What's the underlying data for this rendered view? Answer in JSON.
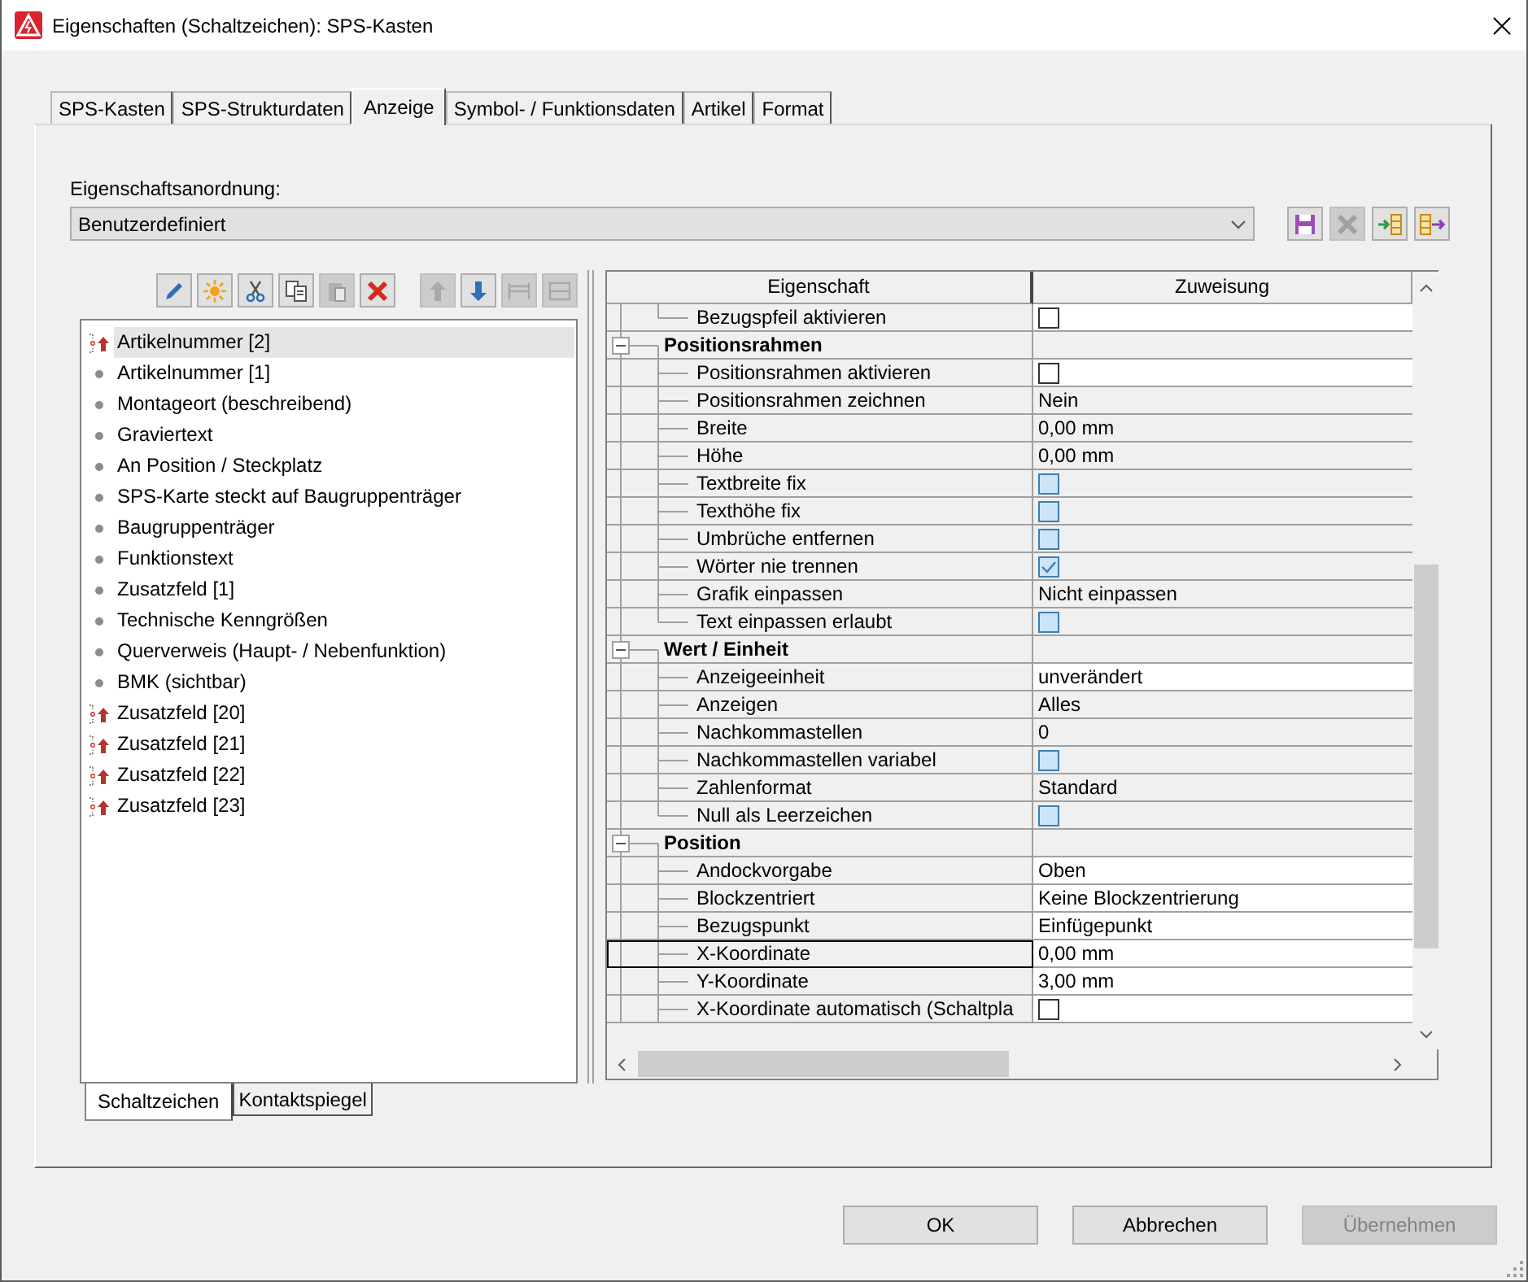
{
  "window": {
    "title": "Eigenschaften (Schaltzeichen): SPS-Kasten"
  },
  "tabs": [
    {
      "label": "SPS-Kasten",
      "selected": false
    },
    {
      "label": "SPS-Strukturdaten",
      "selected": false
    },
    {
      "label": "Anzeige",
      "selected": true
    },
    {
      "label": "Symbol- / Funktionsdaten",
      "selected": false
    },
    {
      "label": "Artikel",
      "selected": false
    },
    {
      "label": "Format",
      "selected": false
    }
  ],
  "arrangement": {
    "label": "Eigenschaftsanordnung:",
    "value": "Benutzerdefiniert",
    "buttons": [
      {
        "kind": "save",
        "disabled": false
      },
      {
        "kind": "delete",
        "disabled": true
      },
      {
        "kind": "import",
        "disabled": false
      },
      {
        "kind": "export",
        "disabled": false
      }
    ]
  },
  "toolbar": [
    {
      "kind": "edit",
      "disabled": false
    },
    {
      "kind": "new",
      "disabled": false
    },
    {
      "kind": "cut",
      "disabled": false
    },
    {
      "kind": "copy",
      "disabled": false
    },
    {
      "kind": "paste",
      "disabled": true
    },
    {
      "kind": "delete",
      "disabled": false
    },
    {
      "kind": "up",
      "disabled": true
    },
    {
      "kind": "down",
      "disabled": false
    },
    {
      "kind": "spacing",
      "disabled": true
    },
    {
      "kind": "frame",
      "disabled": true
    }
  ],
  "list": [
    {
      "label": "Artikelnummer [2]",
      "kind": "linked",
      "selected": true
    },
    {
      "label": "Artikelnummer [1]",
      "kind": "plain",
      "selected": false
    },
    {
      "label": "Montageort (beschreibend)",
      "kind": "plain",
      "selected": false
    },
    {
      "label": "Graviertext",
      "kind": "plain",
      "selected": false
    },
    {
      "label": "An Position / Steckplatz",
      "kind": "plain",
      "selected": false
    },
    {
      "label": "SPS-Karte steckt auf Baugruppenträger",
      "kind": "plain",
      "selected": false
    },
    {
      "label": "Baugruppenträger",
      "kind": "plain",
      "selected": false
    },
    {
      "label": "Funktionstext",
      "kind": "plain",
      "selected": false
    },
    {
      "label": "Zusatzfeld [1]",
      "kind": "plain",
      "selected": false
    },
    {
      "label": "Technische Kenngrößen",
      "kind": "plain",
      "selected": false
    },
    {
      "label": "Querverweis (Haupt- / Nebenfunktion)",
      "kind": "plain",
      "selected": false
    },
    {
      "label": "BMK (sichtbar)",
      "kind": "plain",
      "selected": false
    },
    {
      "label": "Zusatzfeld [20]",
      "kind": "linked",
      "selected": false
    },
    {
      "label": "Zusatzfeld [21]",
      "kind": "linked",
      "selected": false
    },
    {
      "label": "Zusatzfeld [22]",
      "kind": "linked",
      "selected": false
    },
    {
      "label": "Zusatzfeld [23]",
      "kind": "linked",
      "selected": false
    }
  ],
  "bottom_tabs": [
    {
      "label": "Schaltzeichen",
      "selected": true
    },
    {
      "label": "Kontaktspiegel",
      "selected": false
    }
  ],
  "grid": {
    "columns": [
      "Eigenschaft",
      "Zuweisung"
    ],
    "rows": [
      {
        "kind": "checkbox",
        "label": "Bezugspfeil aktivieren",
        "checked": false,
        "editable": true,
        "selected": false
      },
      {
        "kind": "group",
        "label": "Positionsrahmen",
        "expanded": true,
        "children": [
          {
            "kind": "checkbox",
            "label": "Positionsrahmen aktivieren",
            "checked": false,
            "editable": true,
            "selected": false
          },
          {
            "kind": "text",
            "label": "Positionsrahmen zeichnen",
            "value": "Nein",
            "editable": false,
            "selected": false
          },
          {
            "kind": "text",
            "label": "Breite",
            "value": "0,00 mm",
            "editable": false,
            "selected": false
          },
          {
            "kind": "text",
            "label": "Höhe",
            "value": "0,00 mm",
            "editable": false,
            "selected": false
          },
          {
            "kind": "checkbox",
            "label": "Textbreite fix",
            "checked": false,
            "editable": false,
            "selected": false
          },
          {
            "kind": "checkbox",
            "label": "Texthöhe fix",
            "checked": false,
            "editable": false,
            "selected": false
          },
          {
            "kind": "checkbox",
            "label": "Umbrüche entfernen",
            "checked": false,
            "editable": false,
            "selected": false
          },
          {
            "kind": "checkbox",
            "label": "Wörter nie trennen",
            "checked": true,
            "editable": false,
            "selected": false
          },
          {
            "kind": "text",
            "label": "Grafik einpassen",
            "value": "Nicht einpassen",
            "editable": false,
            "selected": false
          },
          {
            "kind": "checkbox",
            "label": "Text einpassen erlaubt",
            "checked": false,
            "editable": false,
            "selected": false
          }
        ]
      },
      {
        "kind": "group",
        "label": "Wert / Einheit",
        "expanded": true,
        "children": [
          {
            "kind": "text",
            "label": "Anzeigeeinheit",
            "value": "unverändert",
            "editable": true,
            "selected": false
          },
          {
            "kind": "text",
            "label": "Anzeigen",
            "value": "Alles",
            "editable": false,
            "selected": false
          },
          {
            "kind": "text",
            "label": "Nachkommastellen",
            "value": "0",
            "editable": false,
            "selected": false
          },
          {
            "kind": "checkbox",
            "label": "Nachkommastellen variabel",
            "checked": false,
            "editable": false,
            "selected": false
          },
          {
            "kind": "text",
            "label": "Zahlenformat",
            "value": "Standard",
            "editable": false,
            "selected": false
          },
          {
            "kind": "checkbox",
            "label": "Null als Leerzeichen",
            "checked": false,
            "editable": false,
            "selected": false
          }
        ]
      },
      {
        "kind": "group",
        "label": "Position",
        "expanded": true,
        "children": [
          {
            "kind": "text",
            "label": "Andockvorgabe",
            "value": "Oben",
            "editable": true,
            "selected": false
          },
          {
            "kind": "text",
            "label": "Blockzentriert",
            "value": "Keine Blockzentrierung",
            "editable": true,
            "selected": false
          },
          {
            "kind": "text",
            "label": "Bezugspunkt",
            "value": "Einfügepunkt",
            "editable": true,
            "selected": false
          },
          {
            "kind": "text",
            "label": "X-Koordinate",
            "value": "0,00 mm",
            "editable": true,
            "selected": true
          },
          {
            "kind": "text",
            "label": "Y-Koordinate",
            "value": "3,00 mm",
            "editable": true,
            "selected": false
          },
          {
            "kind": "checkbox",
            "label": "X-Koordinate automatisch (Schaltpla",
            "checked": false,
            "editable": true,
            "selected": false
          }
        ]
      }
    ]
  },
  "buttons": [
    {
      "label": "OK",
      "disabled": false
    },
    {
      "label": "Abbrechen",
      "disabled": false
    },
    {
      "label": "Übernehmen",
      "disabled": true
    }
  ]
}
